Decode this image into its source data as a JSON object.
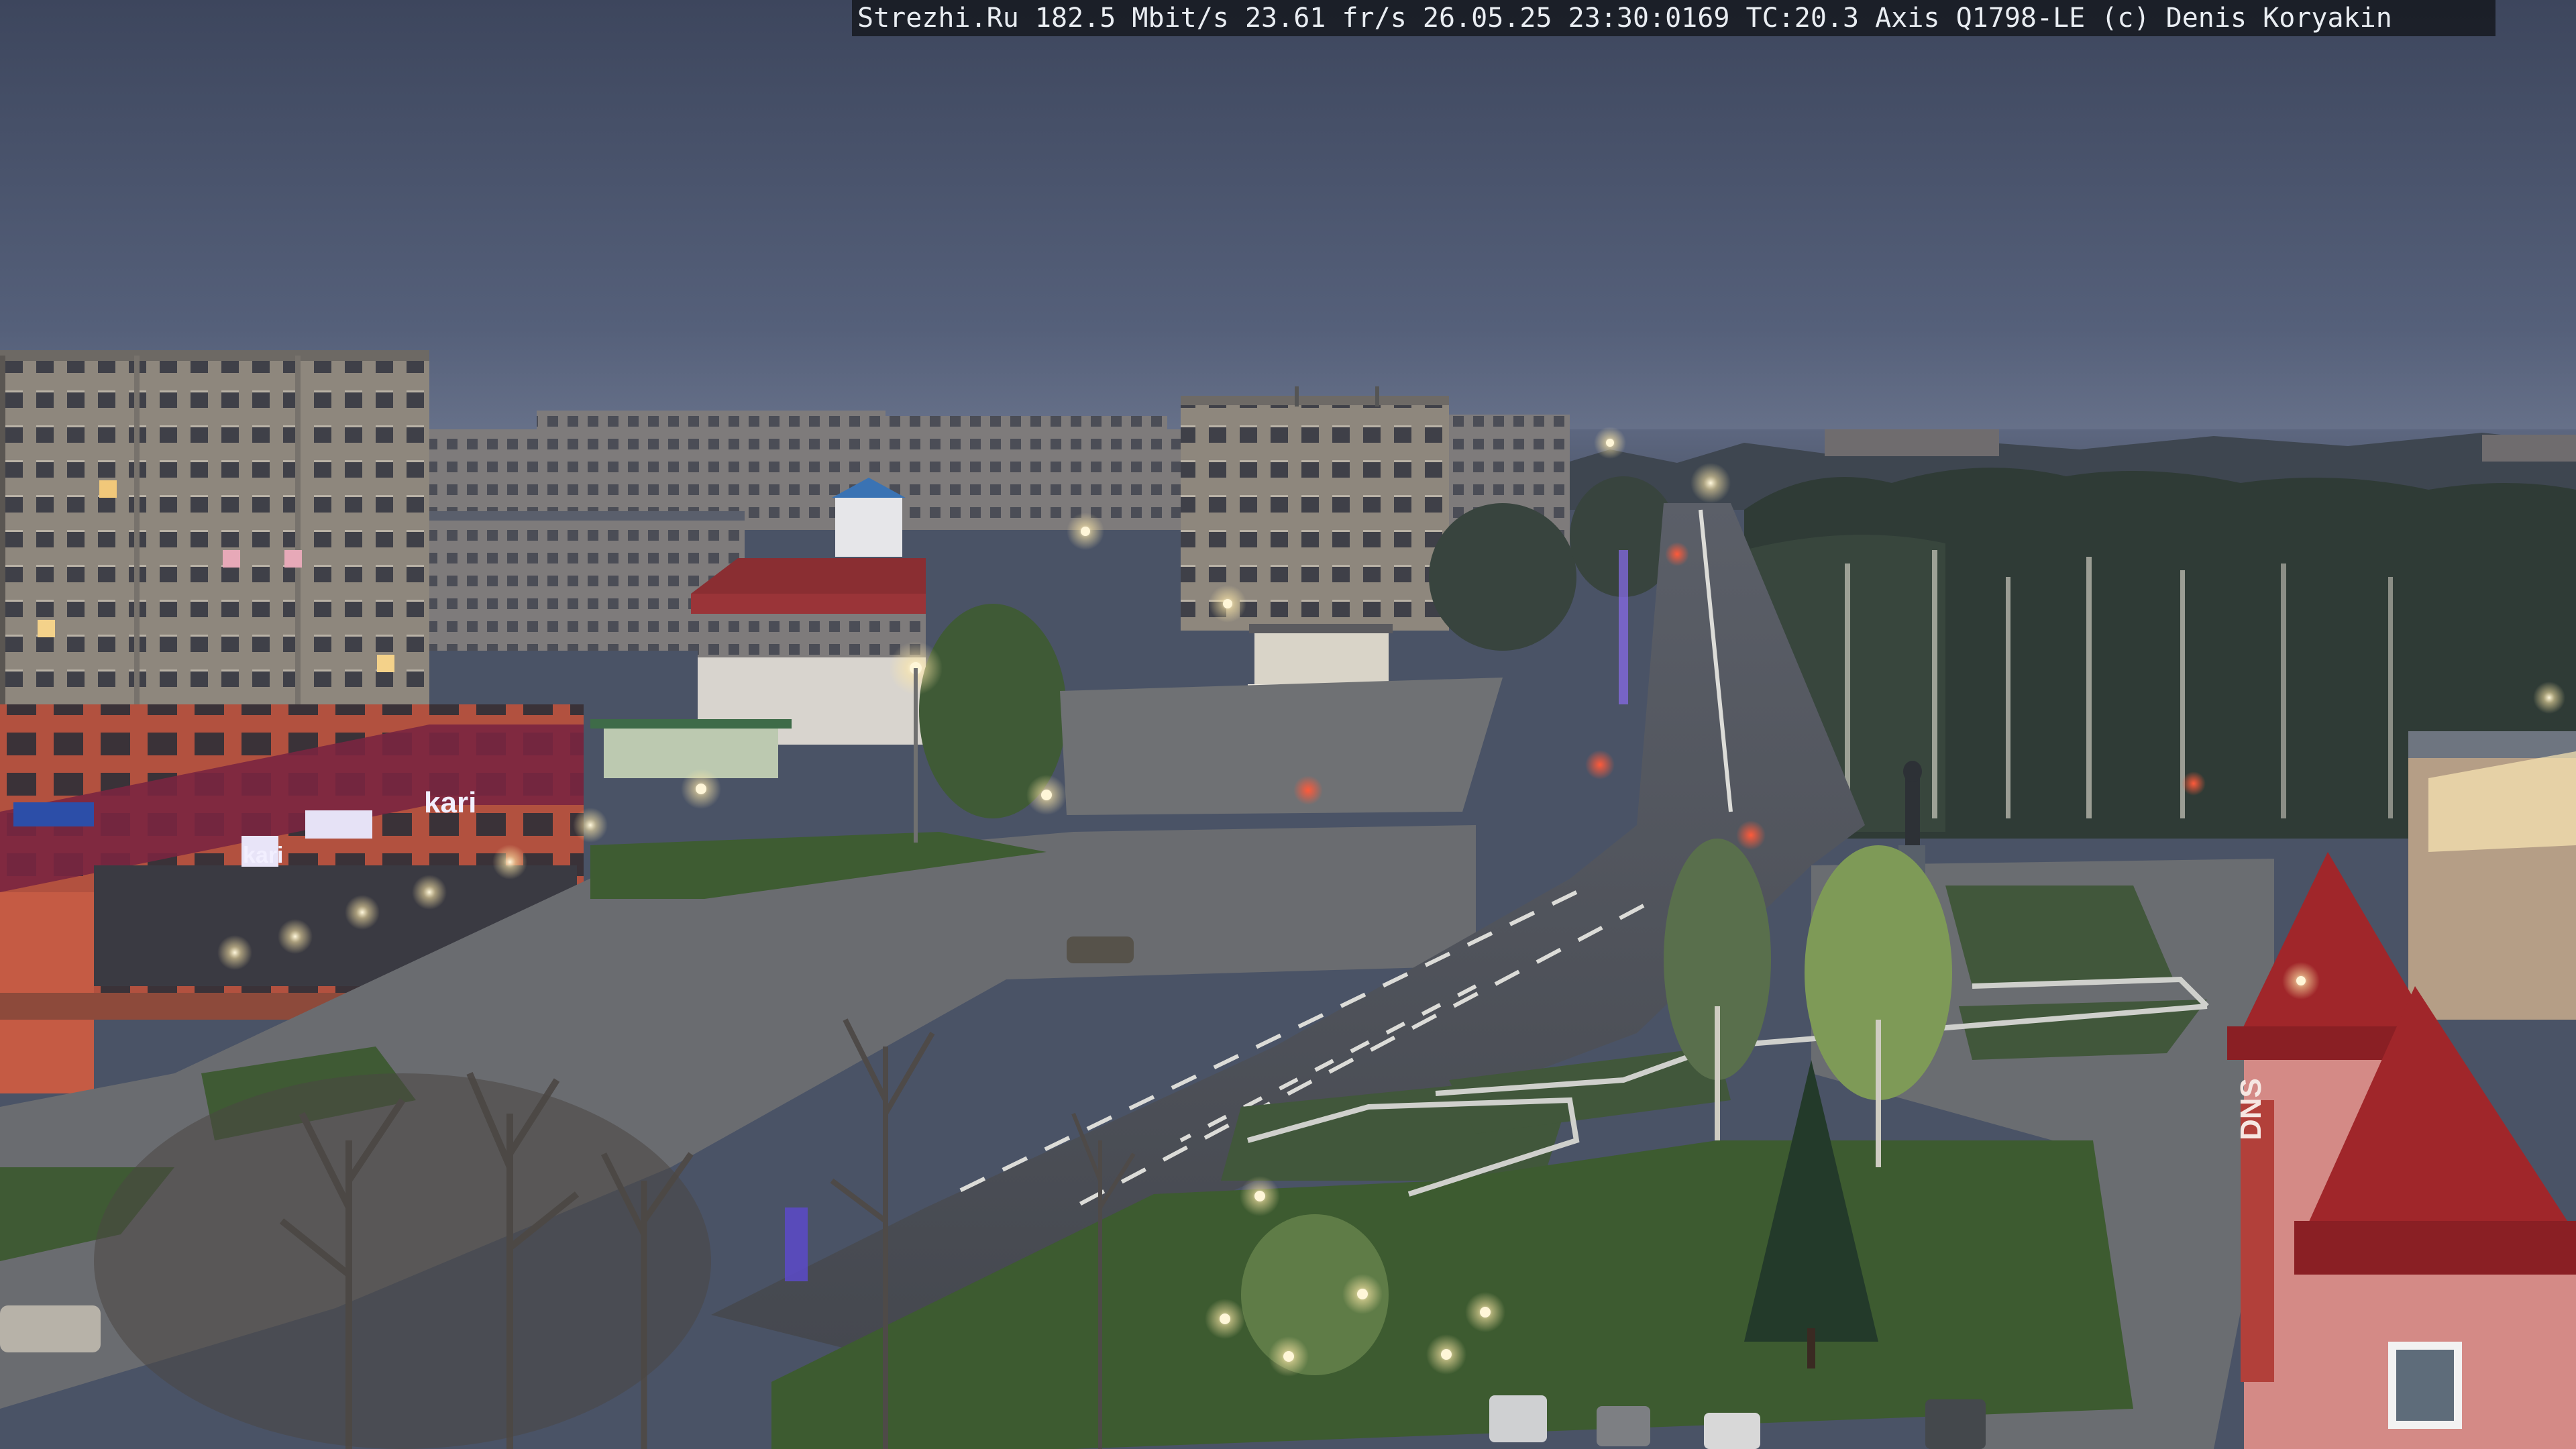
{
  "overlay": {
    "caption": "Strezhi.Ru 182.5 Mbit/s 23.61 fr/s 26.05.25 23:30:0169 TC:20.3  Axis Q1798-LE  (c) Denis Koryakin"
  },
  "signs": {
    "store_left": "kari",
    "store_left_small": "kari",
    "store_right": "DNS"
  },
  "colors": {
    "sky_top": "#3f4860",
    "sky_horizon": "#6c7690",
    "road": "#4d5057",
    "lawn": "#3e5c32",
    "brick": "#b2513f",
    "roof_red": "#a0262a",
    "lamp": "#fff6d8"
  }
}
